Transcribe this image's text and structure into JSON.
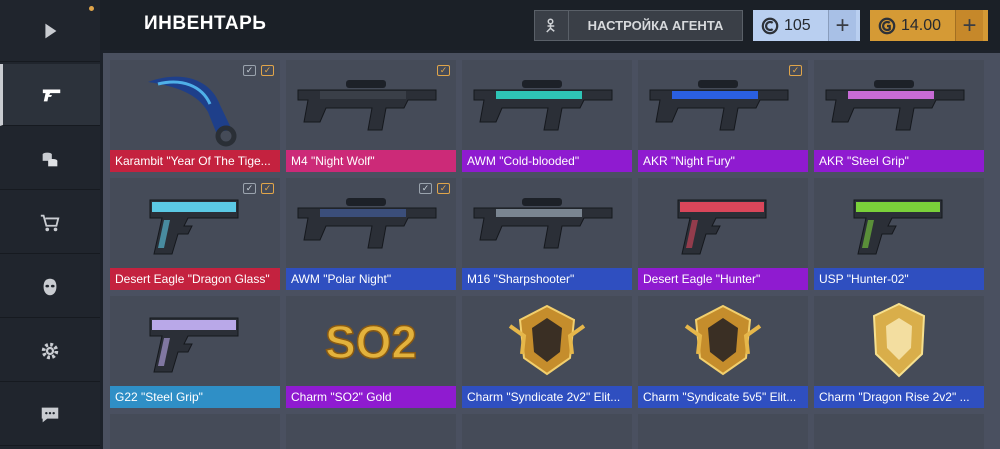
{
  "header": {
    "title": "ИНВЕНТАРЬ",
    "agent_button_label": "НАСТРОЙКА АГЕНТА",
    "currency_blue": {
      "value": "105",
      "icon": "credit-icon",
      "color": "#b9cff0"
    },
    "currency_gold": {
      "value": "14.00",
      "icon": "gold-icon",
      "color": "#d59a35"
    },
    "plus_label": "+"
  },
  "sidebar": {
    "items": [
      {
        "icon": "play-icon",
        "active": false
      },
      {
        "icon": "pistol-icon",
        "active": true
      },
      {
        "icon": "coins-icon",
        "active": false
      },
      {
        "icon": "cart-icon",
        "active": false
      },
      {
        "icon": "mask-icon",
        "active": false
      },
      {
        "icon": "gear-icon",
        "active": false
      },
      {
        "icon": "chat-icon",
        "active": false
      }
    ]
  },
  "rarity_colors": {
    "red": "#c4223f",
    "pink": "#cc2a78",
    "purple": "#8f1bd0",
    "blue": "#2f4fc0",
    "light_blue": "#2f8fc6"
  },
  "items": [
    {
      "name": "Karambit \"Year Of The Tige...",
      "rarity": "red",
      "art": "karambit",
      "checks": 2
    },
    {
      "name": "M4 \"Night Wolf\"",
      "rarity": "pink",
      "art": "rifle-dark",
      "checks": 1
    },
    {
      "name": "AWM \"Cold-blooded\"",
      "rarity": "purple",
      "art": "sniper-teal",
      "checks": 0
    },
    {
      "name": "AKR \"Night Fury\"",
      "rarity": "purple",
      "art": "ak-blue",
      "checks": 1
    },
    {
      "name": "AKR \"Steel Grip\"",
      "rarity": "purple",
      "art": "ak-pink",
      "checks": 0
    },
    {
      "name": "Desert Eagle \"Dragon Glass\"",
      "rarity": "red",
      "art": "deagle-blue",
      "checks": 2
    },
    {
      "name": "AWM \"Polar Night\"",
      "rarity": "blue",
      "art": "sniper-dark",
      "checks": 2
    },
    {
      "name": "M16 \"Sharpshooter\"",
      "rarity": "blue",
      "art": "rifle-grey",
      "checks": 0
    },
    {
      "name": "Desert Eagle \"Hunter\"",
      "rarity": "purple",
      "art": "deagle-red",
      "checks": 0
    },
    {
      "name": "USP \"Hunter-02\"",
      "rarity": "blue",
      "art": "usp-green",
      "checks": 0
    },
    {
      "name": "G22 \"Steel Grip\"",
      "rarity": "light_blue",
      "art": "pistol-purple",
      "checks": 0
    },
    {
      "name": "Charm \"SO2\" Gold",
      "rarity": "purple",
      "art": "charm-so2",
      "checks": 0,
      "charm_text": "SO2"
    },
    {
      "name": "Charm \"Syndicate 2v2\" Elit...",
      "rarity": "blue",
      "art": "charm-badge",
      "checks": 0
    },
    {
      "name": "Charm \"Syndicate 5v5\" Elit...",
      "rarity": "blue",
      "art": "charm-badge",
      "checks": 0
    },
    {
      "name": "Charm \"Dragon Rise 2v2\" ...",
      "rarity": "blue",
      "art": "charm-shield",
      "checks": 0
    }
  ]
}
